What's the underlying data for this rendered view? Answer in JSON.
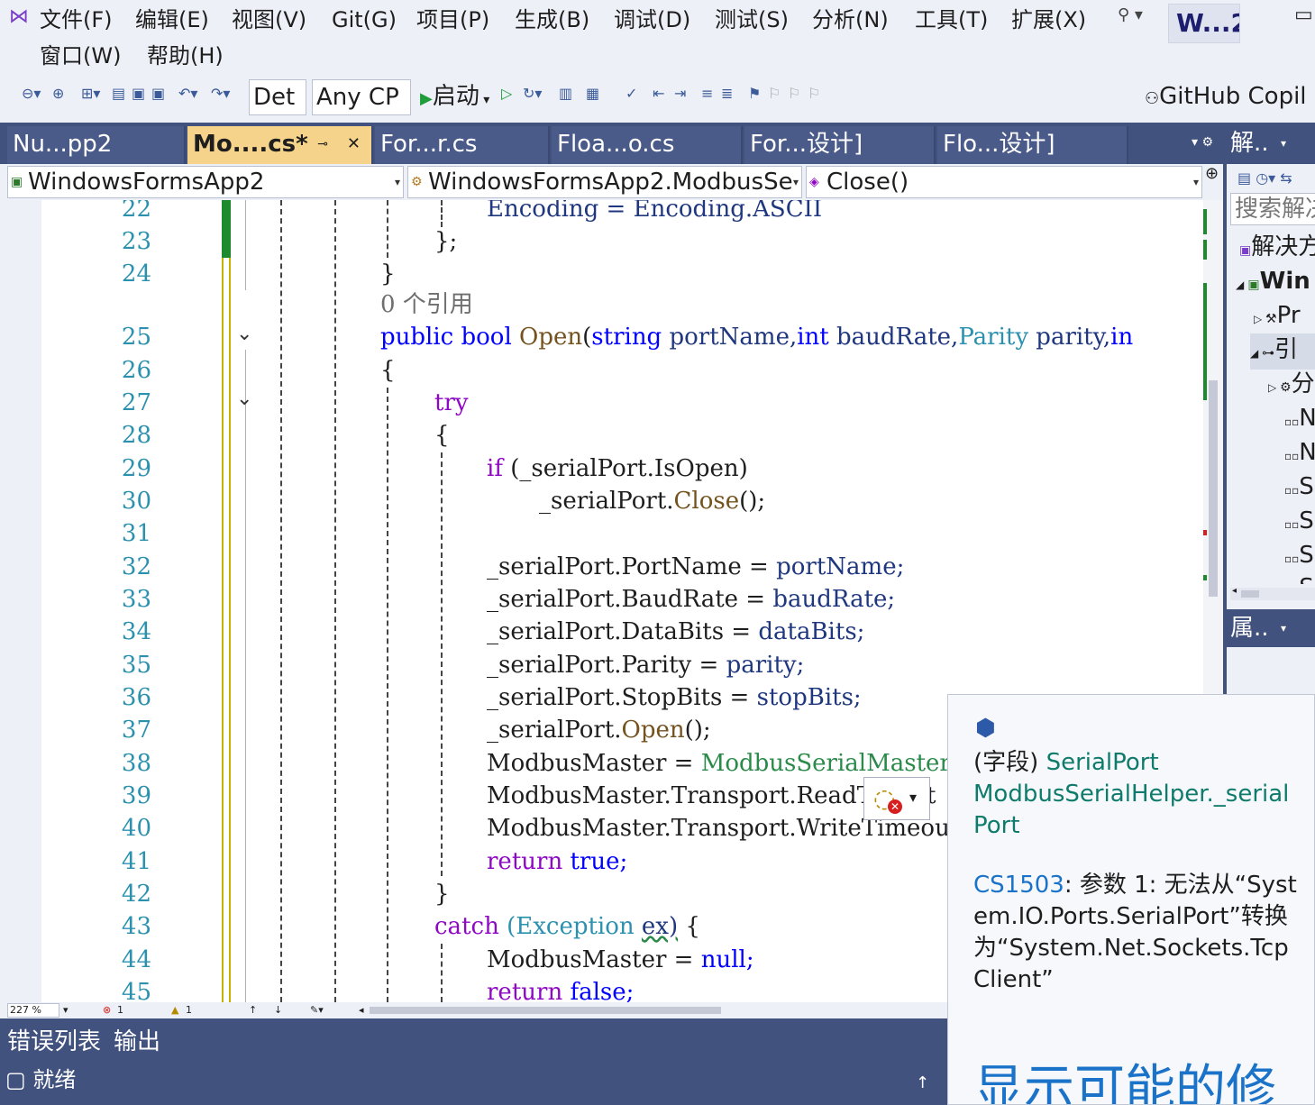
{
  "menu": [
    "文件(F)",
    "编辑(E)",
    "视图(V)",
    "Git(G)",
    "项目(P)",
    "生成(B)",
    "调试(D)",
    "测试(S)",
    "分析(N)",
    "工具(T)",
    "扩展(X)",
    "窗口(W)",
    "帮助(H)"
  ],
  "window_title": "W...2",
  "toolbar": {
    "config": "Det",
    "platform": "Any CP",
    "start": "启动",
    "copilot": "GitHub Copil"
  },
  "tabs": [
    {
      "label": "Nu...pp2"
    },
    {
      "label": "Mo....cs*"
    },
    {
      "label": "For...r.cs"
    },
    {
      "label": "Floa...o.cs"
    },
    {
      "label": "For...设计]"
    },
    {
      "label": "Flo...设计]"
    }
  ],
  "nav": {
    "project": "WindowsFormsApp2",
    "class": "WindowsFormsApp2.ModbusSe",
    "member": "Close()"
  },
  "code": {
    "l22": "Encoding = Encoding.ASCII",
    "l23": "};",
    "l24": "}",
    "refs": "0 个引用",
    "l25_kw": "public bool",
    "l25_name": "Open",
    "l25_s": "string",
    "l25_p1": "portName,",
    "l25_i": "int",
    "l25_p2": "baudRate,",
    "l25_t": "Parity",
    "l25_p3": "parity,",
    "l25_tail": "in",
    "l26": "{",
    "l27": "try",
    "l28": "{",
    "l29_kw": "if",
    "l29_rest": "(_serialPort.IsOpen)",
    "l30_a": "_serialPort.",
    "l30_m": "Close",
    "l30_b": "();",
    "l32_a": "_serialPort.PortName =",
    "l32_b": "portName;",
    "l33_a": "_serialPort.BaudRate =",
    "l33_b": "baudRate;",
    "l34_a": "_serialPort.DataBits =",
    "l34_b": "dataBits;",
    "l35_a": "_serialPort.Parity =",
    "l35_b": "parity;",
    "l36_a": "_serialPort.StopBits =",
    "l36_b": "stopBits;",
    "l37_a": "_serialPort.",
    "l37_m": "Open",
    "l37_b": "();",
    "l38_a": "ModbusMaster =",
    "l38_b": "ModbusSerialMaster.C",
    "l39": "ModbusMaster.Transport.ReadT",
    "l39_tail": "t",
    "l40": "ModbusMaster.Transport.WriteTimeout",
    "l41_kw": "return",
    "l41_v": "true;",
    "l42": "}",
    "l43_kw": "catch",
    "l43_t": "(Exception",
    "l43_v": "ex)",
    "l43_b": "{",
    "l44_a": "ModbusMaster =",
    "l44_b": "null;",
    "l45_kw": "return",
    "l45_v": "false;"
  },
  "lines": [
    "22",
    "23",
    "24",
    "25",
    "26",
    "27",
    "28",
    "29",
    "30",
    "31",
    "32",
    "33",
    "34",
    "35",
    "36",
    "37",
    "38",
    "39",
    "40",
    "41",
    "42",
    "43",
    "44",
    "45"
  ],
  "editor_status": {
    "zoom": "227 %",
    "errors": "1",
    "warnings": "1"
  },
  "bottom": {
    "errors_tab": "错误列表",
    "output_tab": "输出",
    "status": "就绪"
  },
  "solution": {
    "header": "解..",
    "search": "搜索解决",
    "rows": [
      "解决方",
      "Win",
      "Pr",
      "引",
      "分",
      "N",
      "N",
      "S",
      "S",
      "S",
      "S"
    ]
  },
  "properties": {
    "header": "属.."
  },
  "tooltip": {
    "kind": "(字段)",
    "type": "SerialPort",
    "member": "ModbusSerialHelper._serialPort",
    "code": "CS1503",
    "message": ": 参数 1: 无法从“System.IO.Ports.SerialPort”转换为“System.Net.Sockets.TcpClient”",
    "fix": "显示可能的修"
  },
  "colors": {
    "accent": "#42527f",
    "active_tab": "#f6d38b",
    "keyword": "#0000ff",
    "type": "#2b91af"
  }
}
